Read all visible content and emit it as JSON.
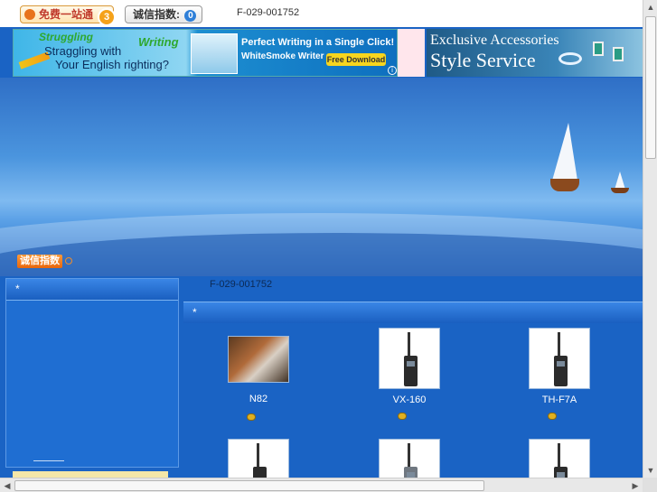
{
  "topbar": {
    "one_stop_label": "免费一站通",
    "one_stop_badge": "3",
    "credit_label": "诚信指数:",
    "credit_count": "0",
    "company_code": "F-029-001752"
  },
  "ads": {
    "left": {
      "struggling": "Struggling",
      "straggling": "Straggling with",
      "english": "Your English righting?",
      "writing": "Writing",
      "headline": "Perfect Writing in a Single Click!",
      "sub": "WhiteSmoke Writer",
      "download": "Free Download",
      "info": "i"
    },
    "right": {
      "line1": "Exclusive Accessories",
      "line2": "Style Service"
    }
  },
  "banner": {
    "credit_label": "诚信指数"
  },
  "sidebar": {
    "header": "*"
  },
  "main": {
    "title": "F-029-001752",
    "header": "*",
    "products": [
      {
        "name": "N82"
      },
      {
        "name": "VX-160"
      },
      {
        "name": "TH-F7A"
      },
      {
        "name": ""
      },
      {
        "name": ""
      },
      {
        "name": ""
      }
    ]
  },
  "scroll": {
    "up": "▲",
    "down": "▼",
    "left": "◀",
    "right": "▶"
  },
  "colors": {
    "page_blue": "#1a63c4",
    "header_blue": "#3a86e6",
    "accent_orange": "#e8660c"
  }
}
